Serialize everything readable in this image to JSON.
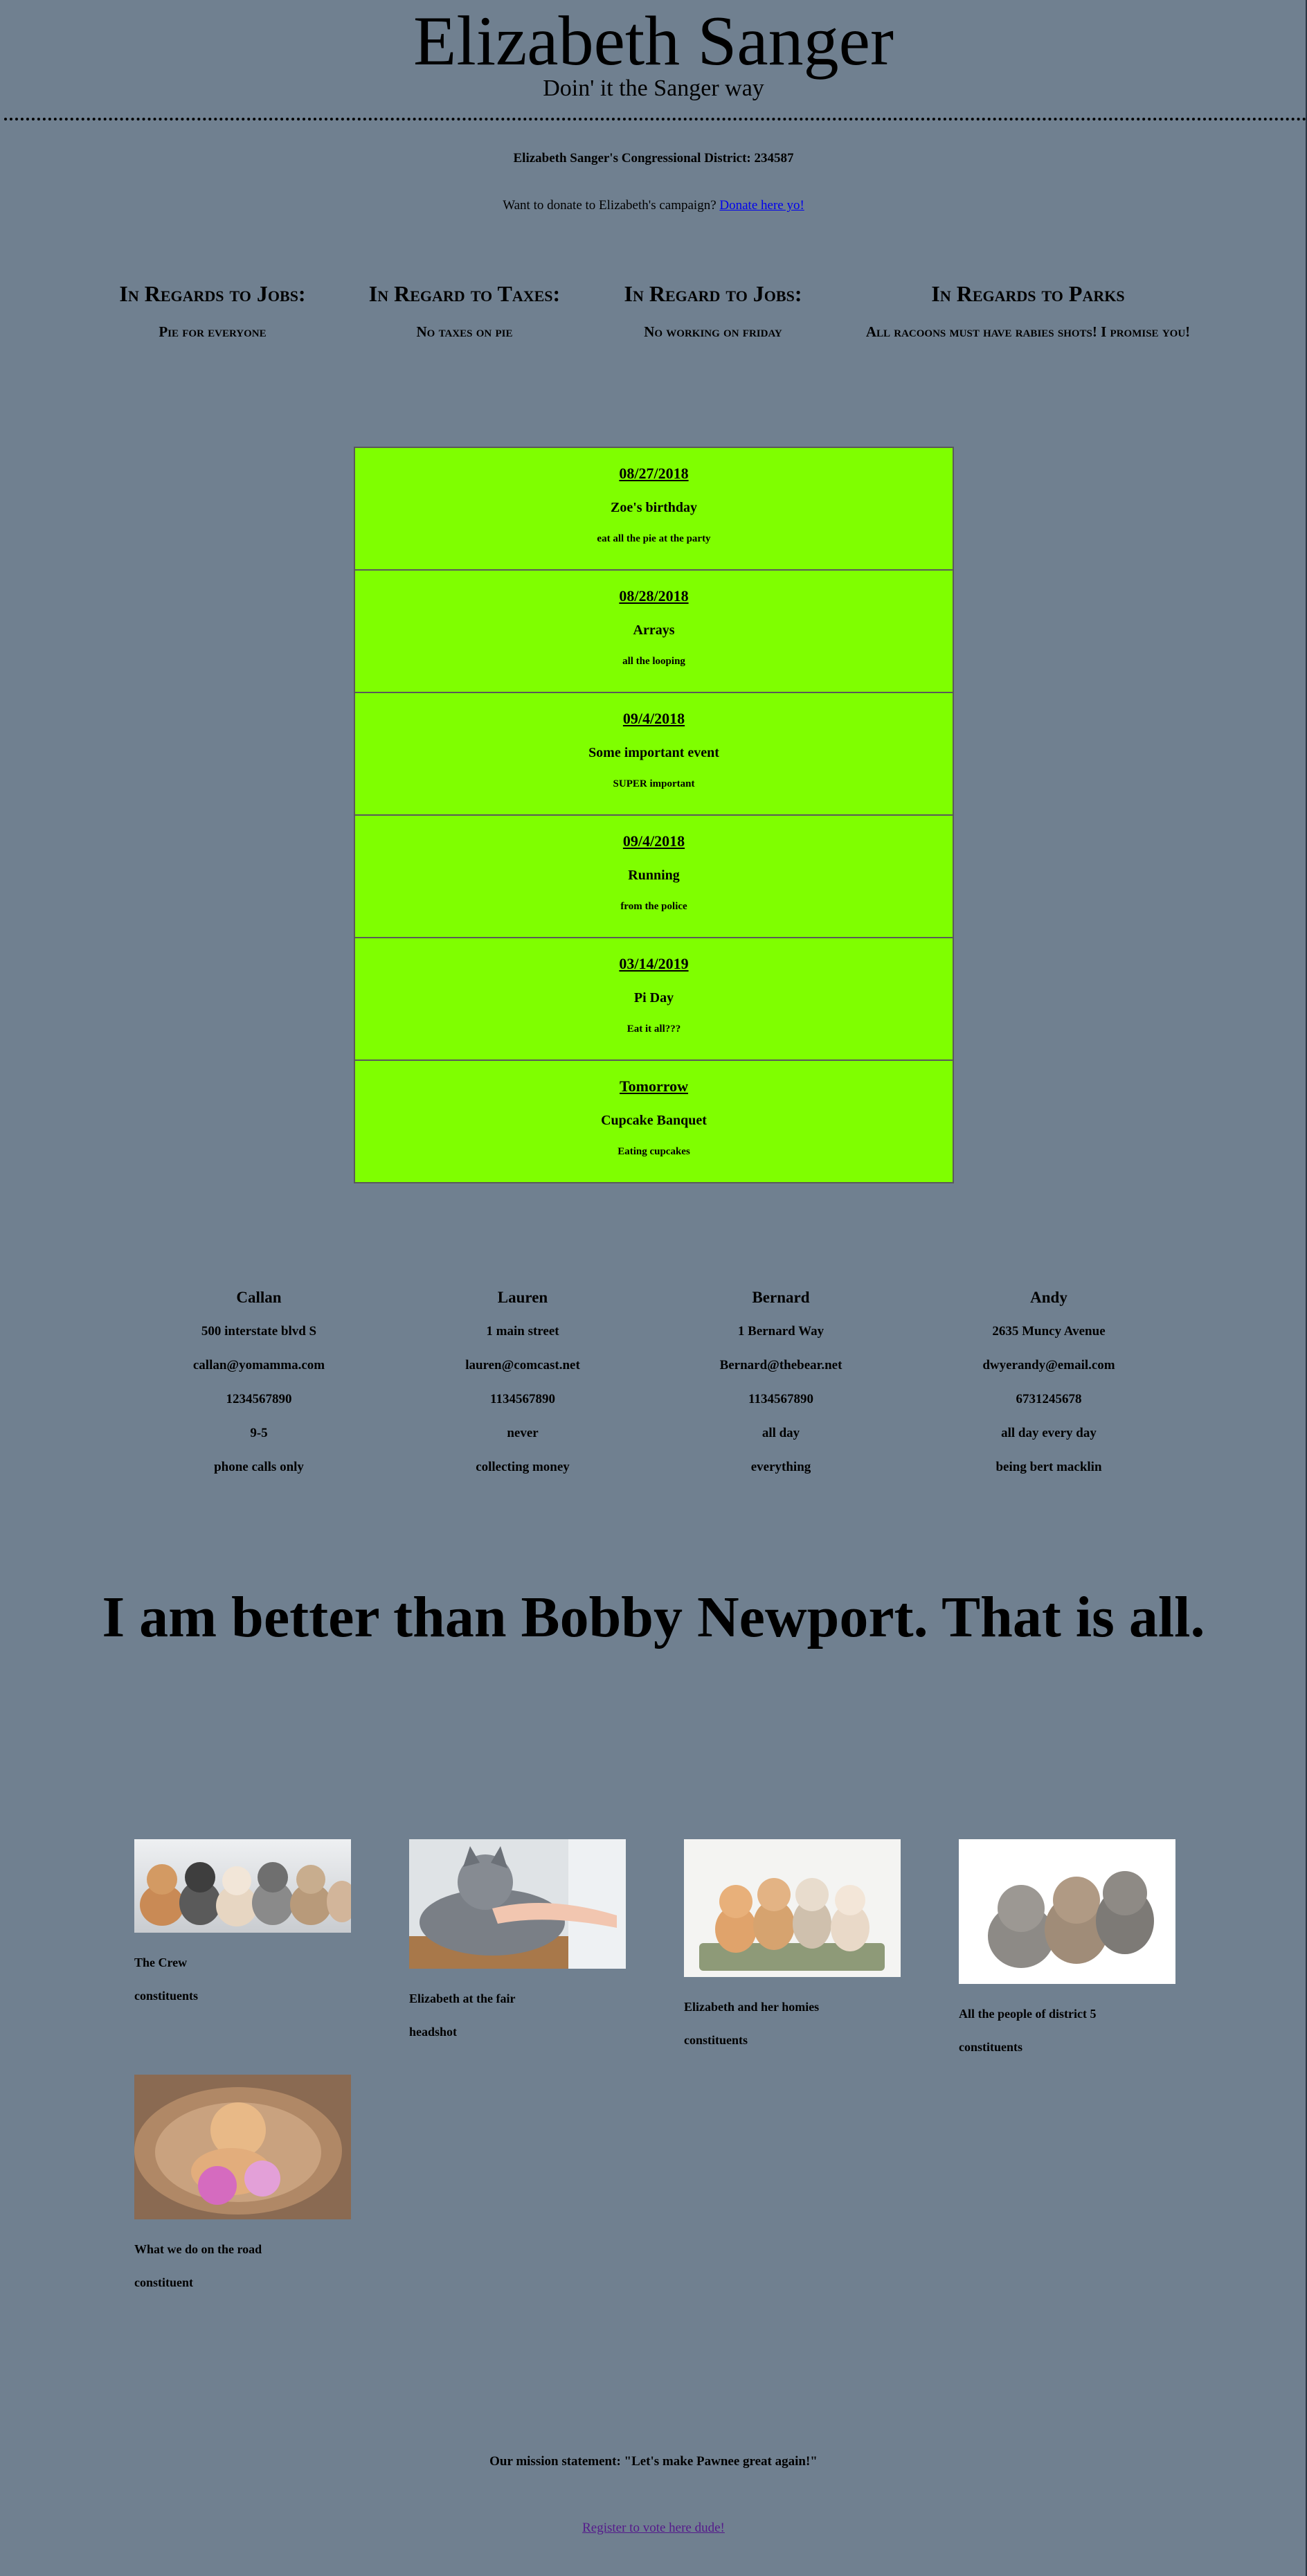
{
  "header": {
    "title": "Elizabeth Sanger",
    "subtitle": "Doin' it the Sanger way"
  },
  "district": "Elizabeth Sanger's Congressional District: 234587",
  "donate": {
    "prefix": "Want to donate to Elizabeth's campaign? ",
    "link": "Donate here yo!"
  },
  "issues": [
    {
      "heading": "In Regards to Jobs:",
      "body": "Pie for everyone"
    },
    {
      "heading": "In Regard to Taxes:",
      "body": "No taxes on pie"
    },
    {
      "heading": "In Regard to Jobs:",
      "body": "No working on friday"
    },
    {
      "heading": "In Regards to Parks",
      "body": "All racoons must have rabies shots! I promise you!"
    }
  ],
  "events": [
    {
      "date": "08/27/2018",
      "name": "Zoe's birthday",
      "desc": "eat all the pie at the party"
    },
    {
      "date": "08/28/2018",
      "name": "Arrays",
      "desc": "all the looping"
    },
    {
      "date": "09/4/2018",
      "name": "Some important event",
      "desc": "SUPER important"
    },
    {
      "date": "09/4/2018",
      "name": "Running",
      "desc": "from the police"
    },
    {
      "date": "03/14/2019",
      "name": "Pi Day",
      "desc": "Eat it all???"
    },
    {
      "date": "Tomorrow",
      "name": "Cupcake Banquet",
      "desc": "Eating cupcakes"
    }
  ],
  "staff": [
    {
      "name": "Callan",
      "address": "500 interstate blvd S",
      "email": "callan@yomamma.com",
      "phone": "1234567890",
      "hours": "9-5",
      "note": "phone calls only"
    },
    {
      "name": "Lauren",
      "address": "1 main street",
      "email": "lauren@comcast.net",
      "phone": "1134567890",
      "hours": "never",
      "note": "collecting money"
    },
    {
      "name": "Bernard",
      "address": "1 Bernard Way",
      "email": "Bernard@thebear.net",
      "phone": "1134567890",
      "hours": "all day",
      "note": "everything"
    },
    {
      "name": "Andy",
      "address": "2635 Muncy Avenue",
      "email": "dwyerandy@email.com",
      "phone": "6731245678",
      "hours": "all day every day",
      "note": "being bert macklin"
    }
  ],
  "slogan": "I am better than Bobby Newport. That is all.",
  "gallery": [
    {
      "caption": "The Crew",
      "sub": "constituents",
      "image": "row of kittens"
    },
    {
      "caption": "Elizabeth at the fair",
      "sub": "headshot",
      "image": "grey cat with hand"
    },
    {
      "caption": "Elizabeth and her homies",
      "sub": "constituents",
      "image": "kittens in basket"
    },
    {
      "caption": "All the people of district 5",
      "sub": "constituents",
      "image": "three tabby kittens"
    },
    {
      "caption": "What we do on the road",
      "sub": "constituent",
      "image": "kitten with yarn"
    }
  ],
  "mission": "Our mission statement: \"Let's make Pawnee great again!\"",
  "register": "Register to vote here dude!"
}
